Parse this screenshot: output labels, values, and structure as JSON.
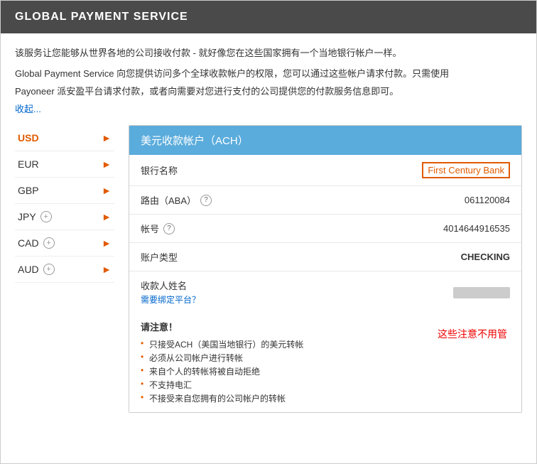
{
  "header": {
    "title": "GLOBAL PAYMENT SERVICE"
  },
  "intro": {
    "line1": "该服务让您能够从世界各地的公司接收付款 - 就好像您在这些国家拥有一个当地银行帐户一样。",
    "line2": "Global Payment Service 向您提供访问多个全球收款帐户的权限，您可以通过这些帐户请求付款。只需使用",
    "line3": "Payoneer 派安盈平台请求付款，或者向需要对您进行支付的公司提供您的付款服务信息即可。",
    "collapse": "收起..."
  },
  "sidebar": {
    "items": [
      {
        "label": "USD",
        "active": true,
        "hasPlus": false
      },
      {
        "label": "EUR",
        "active": false,
        "hasPlus": false
      },
      {
        "label": "GBP",
        "active": false,
        "hasPlus": false
      },
      {
        "label": "JPY",
        "active": false,
        "hasPlus": true
      },
      {
        "label": "CAD",
        "active": false,
        "hasPlus": true
      },
      {
        "label": "AUD",
        "active": false,
        "hasPlus": true
      }
    ]
  },
  "account_card": {
    "header": "美元收款帐户（ACH）",
    "rows": [
      {
        "label": "银行名称",
        "value": "First Century Bank",
        "type": "bank"
      },
      {
        "label": "路由（ABA）",
        "value": "061120084",
        "type": "routing",
        "help": true
      },
      {
        "label": "帐号",
        "value": "4014644916535",
        "type": "account",
        "help": true
      },
      {
        "label": "账户类型",
        "value": "CHECKING",
        "type": "account-type"
      }
    ],
    "recipient": {
      "label": "收款人姓名",
      "bind_text": "需要绑定平台？",
      "value_placeholder": ""
    },
    "notes": {
      "title": "请注意！",
      "annotation": "这些注意不用管",
      "items": [
        "只接受ACH（美国当地银行）的美元转帐",
        "必须从公司帐户进行转帐",
        "来自个人的转帐将被自动拒绝",
        "不支持电汇",
        "不接受来自您拥有的公司帐户的转帐"
      ]
    }
  }
}
